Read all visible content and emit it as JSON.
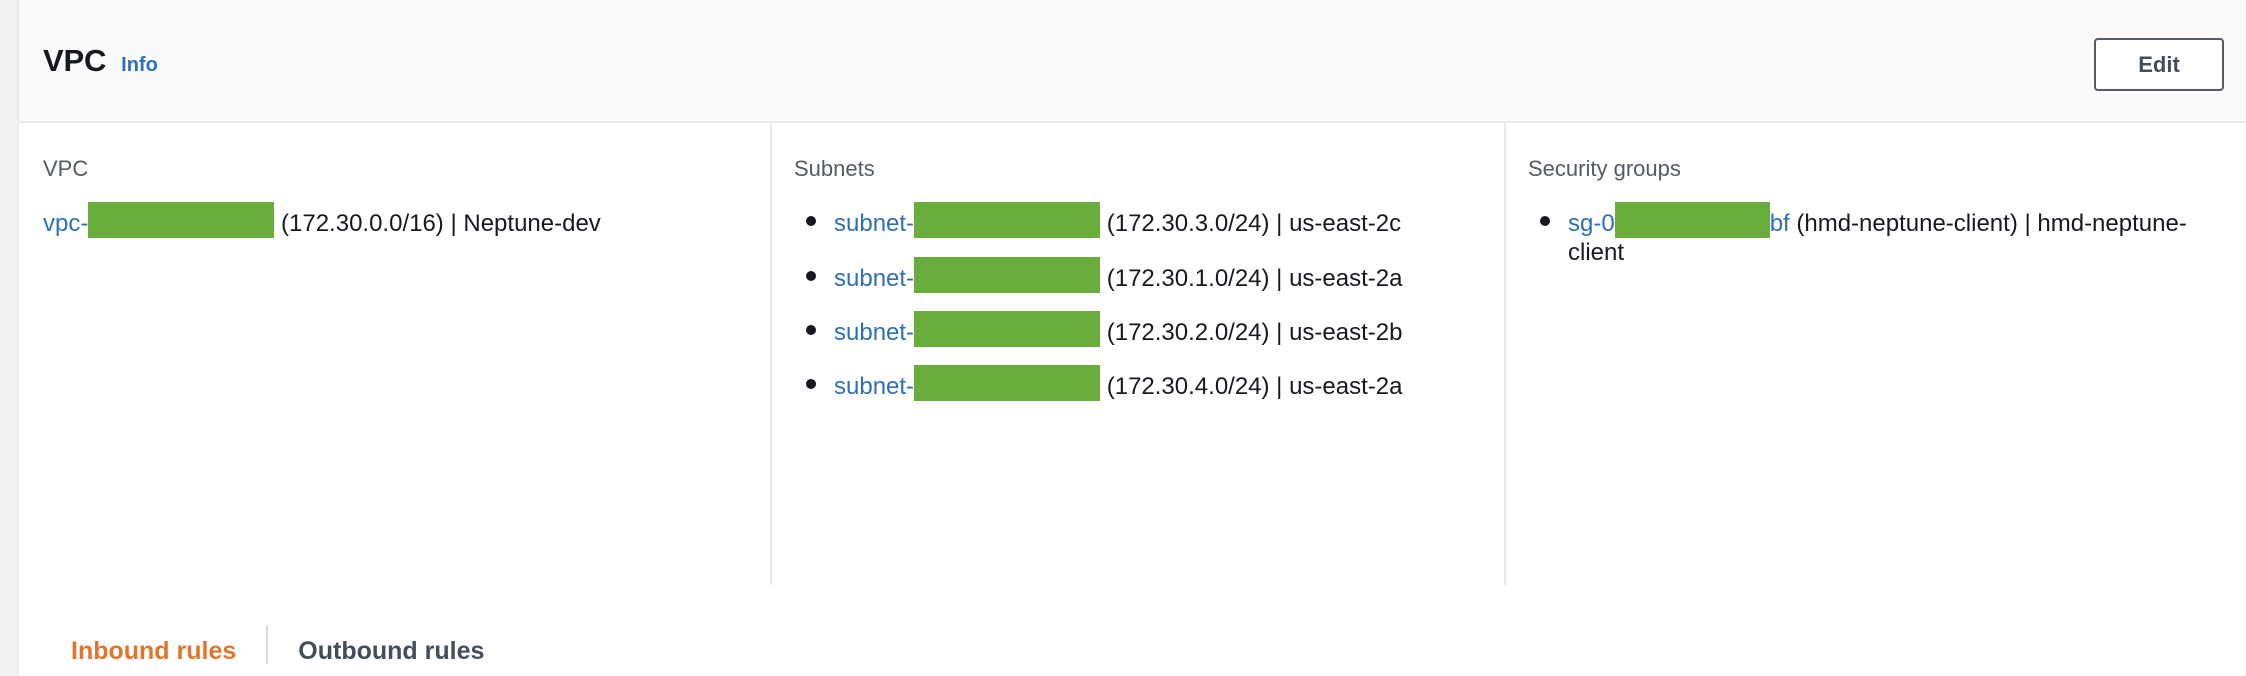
{
  "header": {
    "title": "VPC",
    "info_label": "Info",
    "edit_label": "Edit"
  },
  "colors": {
    "link": "#2f6fb4",
    "redaction": "#69ae3d",
    "active_tab": "#e0762d",
    "inactive_tab": "#444e5b",
    "header_band": "#fafafa",
    "border": "#e9ebed",
    "page_background": "#f2f3f3"
  },
  "columns": {
    "vpc": {
      "label": "VPC",
      "items": [
        {
          "link_prefix": "vpc-",
          "redacted": true,
          "link_suffix": "",
          "details": " (172.30.0.0/16) | Neptune-dev",
          "cidr": "172.30.0.0/16",
          "name": "Neptune-dev"
        }
      ]
    },
    "subnets": {
      "label": "Subnets",
      "items": [
        {
          "link_prefix": "subnet-",
          "redacted": true,
          "link_suffix": "",
          "details": " (172.30.3.0/24) | us-east-2c",
          "cidr": "172.30.3.0/24",
          "availability_zone": "us-east-2c"
        },
        {
          "link_prefix": "subnet-",
          "redacted": true,
          "link_suffix": "",
          "details": " (172.30.1.0/24) | us-east-2a",
          "cidr": "172.30.1.0/24",
          "availability_zone": "us-east-2a"
        },
        {
          "link_prefix": "subnet-",
          "redacted": true,
          "link_suffix": "",
          "details": " (172.30.2.0/24) | us-east-2b",
          "cidr": "172.30.2.0/24",
          "availability_zone": "us-east-2b"
        },
        {
          "link_prefix": "subnet-",
          "redacted": true,
          "link_suffix": "",
          "details": " (172.30.4.0/24) | us-east-2a",
          "cidr": "172.30.4.0/24",
          "availability_zone": "us-east-2a"
        }
      ]
    },
    "security_groups": {
      "label": "Security groups",
      "items": [
        {
          "link_prefix": "sg-0",
          "redacted": true,
          "link_suffix": "bf",
          "details": " (hmd-neptune-client) | hmd-neptune-client",
          "group_name": "hmd-neptune-client",
          "tag_name": "hmd-neptune-client"
        }
      ]
    }
  },
  "tabs": {
    "items": [
      {
        "label": "Inbound rules",
        "active": true
      },
      {
        "label": "Outbound rules",
        "active": false
      }
    ]
  }
}
